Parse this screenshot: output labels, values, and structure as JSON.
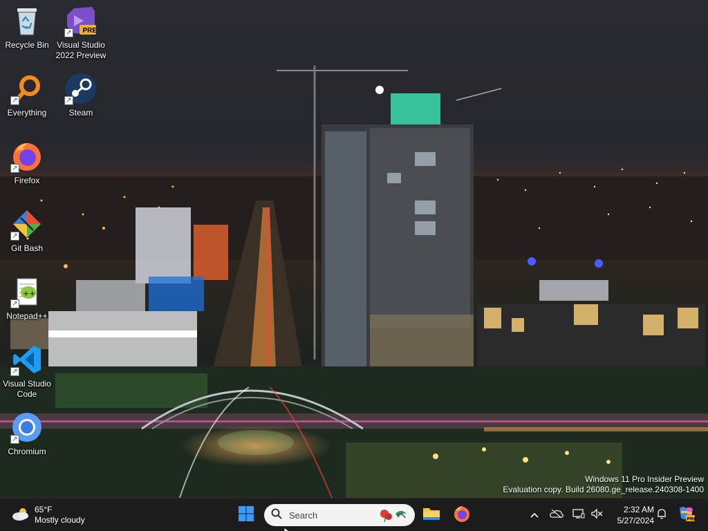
{
  "desktop": {
    "icons": [
      {
        "label": "Recycle Bin",
        "icon": "recycle-bin-icon"
      },
      {
        "label": "Visual Studio 2022 Preview",
        "icon": "visual-studio-preview-icon",
        "badge": "PRE"
      },
      {
        "label": "Everything",
        "icon": "everything-search-icon"
      },
      {
        "label": "Steam",
        "icon": "steam-icon"
      },
      {
        "label": "Firefox",
        "icon": "firefox-icon"
      },
      {
        "label": "Git Bash",
        "icon": "git-bash-icon"
      },
      {
        "label": "Notepad++",
        "icon": "notepad-plus-plus-icon"
      },
      {
        "label": "Visual Studio Code",
        "icon": "vscode-icon"
      },
      {
        "label": "Chromium",
        "icon": "chromium-icon"
      }
    ],
    "shortcut_glyph": "↗",
    "watermark": {
      "line1": "Windows 11 Pro Insider Preview",
      "line2": "Evaluation copy. Build 26080.ge_release.240308-1400"
    }
  },
  "taskbar": {
    "weather": {
      "temp": "65°F",
      "condition": "Mostly cloudy",
      "icon": "cloud-sun-icon"
    },
    "start_icon": "windows-start-icon",
    "search": {
      "placeholder": "Search",
      "icon": "search-icon"
    },
    "pinned": [
      {
        "name": "File Explorer",
        "icon": "file-explorer-icon"
      },
      {
        "name": "Firefox",
        "icon": "firefox-icon"
      }
    ],
    "tray": {
      "icons": [
        "chevron-up-icon",
        "onedrive-icon",
        "display-icon",
        "volume-muted-icon"
      ],
      "time": "2:32 AM",
      "date": "5/27/2024",
      "notification_icon": "bell-icon",
      "copilot_icon": "copilot-pre-icon"
    }
  },
  "colors": {
    "taskbar_bg": "#1c1c1c",
    "accent_blue": "#0078d4",
    "start_blue": "#3a9bfb"
  }
}
